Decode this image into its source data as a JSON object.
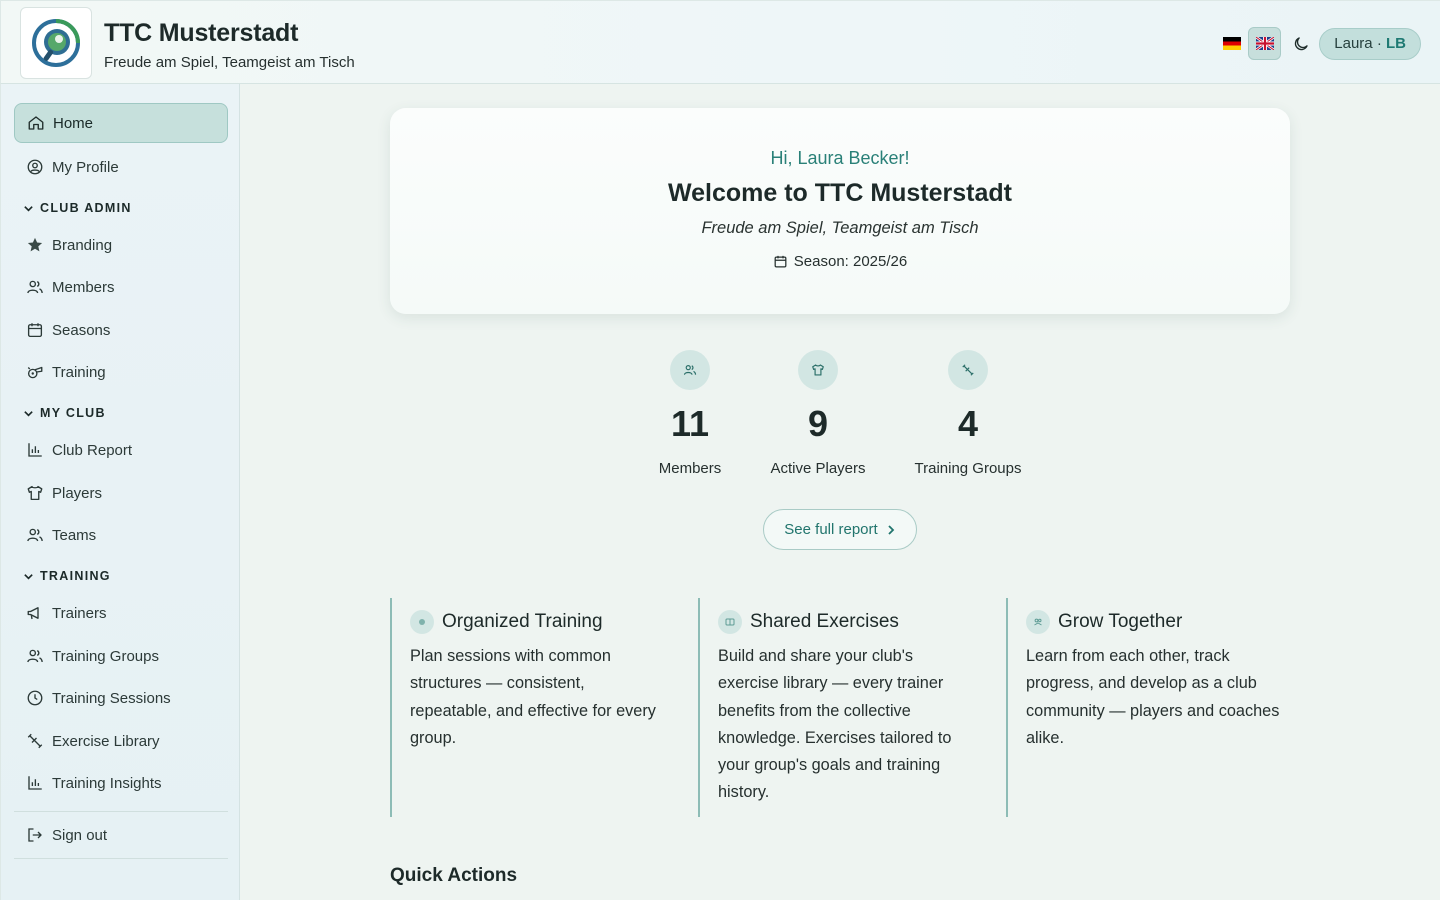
{
  "header": {
    "club_name": "TTC Musterstadt",
    "tagline": "Freude am Spiel, Teamgeist am Tisch",
    "languages": [
      {
        "code": "de",
        "icon": "flag-de-icon"
      },
      {
        "code": "en",
        "icon": "flag-uk-icon",
        "active": true
      }
    ],
    "theme_icon": "moon-icon",
    "user_name": "Laura",
    "user_sep": " · ",
    "user_initials": "LB"
  },
  "sidebar": {
    "top_items": [
      {
        "label": "Home",
        "icon": "home-icon",
        "active": true
      },
      {
        "label": "My Profile",
        "icon": "user-circle-icon"
      }
    ],
    "sections": [
      {
        "title": "CLUB ADMIN",
        "items": [
          {
            "label": "Branding",
            "icon": "star-icon"
          },
          {
            "label": "Members",
            "icon": "users-icon"
          },
          {
            "label": "Seasons",
            "icon": "calendar-icon"
          },
          {
            "label": "Training",
            "icon": "whistle-icon"
          }
        ]
      },
      {
        "title": "MY CLUB",
        "items": [
          {
            "label": "Club Report",
            "icon": "bar-chart-icon"
          },
          {
            "label": "Players",
            "icon": "shirt-icon"
          },
          {
            "label": "Teams",
            "icon": "users-icon"
          }
        ]
      },
      {
        "title": "TRAINING",
        "items": [
          {
            "label": "Trainers",
            "icon": "megaphone-icon"
          },
          {
            "label": "Training Groups",
            "icon": "users-icon"
          },
          {
            "label": "Training Sessions",
            "icon": "clock-icon"
          },
          {
            "label": "Exercise Library",
            "icon": "dumbbell-icon"
          },
          {
            "label": "Training Insights",
            "icon": "bar-chart-icon"
          }
        ]
      }
    ],
    "sign_out": "Sign out"
  },
  "welcome": {
    "greeting": "Hi, Laura Becker!",
    "title": "Welcome to TTC Musterstadt",
    "tagline": "Freude am Spiel, Teamgeist am Tisch",
    "season": "Season: 2025/26"
  },
  "stats": [
    {
      "value": "11",
      "label": "Members",
      "icon": "users-icon"
    },
    {
      "value": "9",
      "label": "Active Players",
      "icon": "shirt-icon"
    },
    {
      "value": "4",
      "label": "Training Groups",
      "icon": "dumbbell-icon"
    }
  ],
  "report_button": "See full report",
  "features": [
    {
      "title": "Organized Training",
      "body": "Plan sessions with common structures — consistent, repeatable, and effective for every group."
    },
    {
      "title": "Shared Exercises",
      "body": "Build and share your club's exercise library — every trainer benefits from the collective knowledge. Exercises tailored to your group's goals and training history."
    },
    {
      "title": "Grow Together",
      "body": "Learn from each other, track progress, and develop as a club community — players and coaches alike."
    }
  ],
  "quick_actions_title": "Quick Actions",
  "colors": {
    "accent": "#2a8078",
    "active_nav_bg": "#c6e0dc",
    "background": "#eef4f1"
  }
}
